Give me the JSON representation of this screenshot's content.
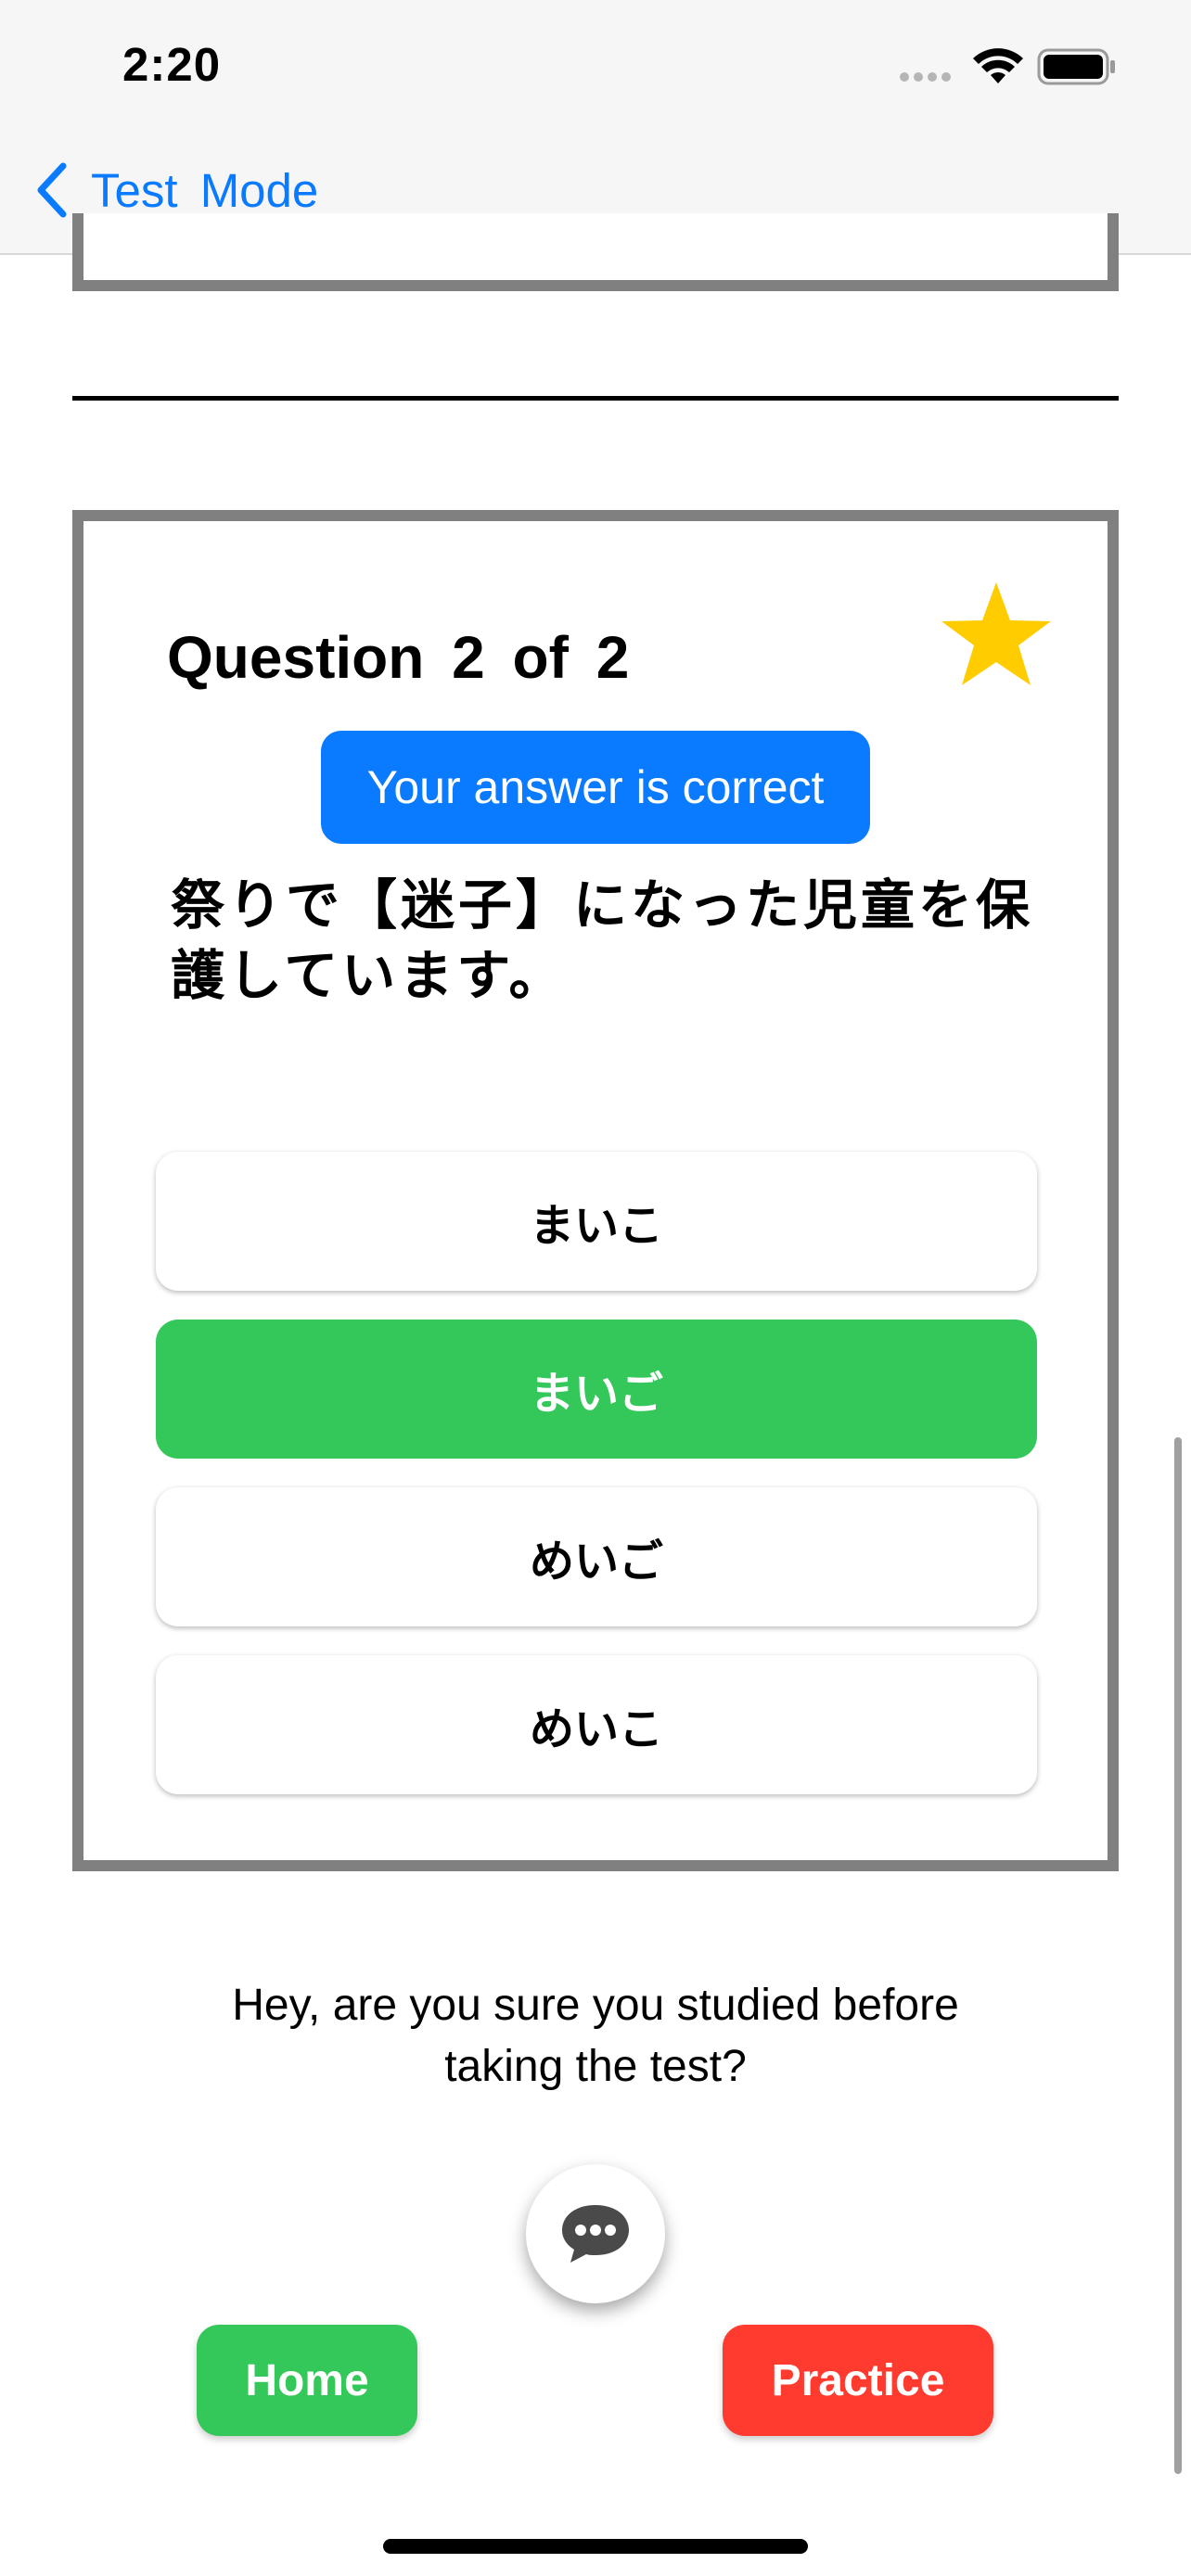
{
  "status_bar": {
    "time": "2:20"
  },
  "nav": {
    "back_label": "Test  Mode"
  },
  "question_card": {
    "title": "Question  2  of  2",
    "result_badge": "Your answer is correct",
    "question_text": "祭りで【迷子】になった児童を保護しています。",
    "options": [
      {
        "label": "まいこ",
        "state": "default"
      },
      {
        "label": "まいご",
        "state": "selected-correct"
      },
      {
        "label": "めいご",
        "state": "default"
      },
      {
        "label": "めいこ",
        "state": "default"
      }
    ]
  },
  "feedback": {
    "message": "Hey, are you sure you studied before taking the test?"
  },
  "buttons": {
    "home_label": "Home",
    "practice_label": "Practice"
  },
  "colors": {
    "accent_blue": "#0a7aff",
    "correct_green": "#34c759",
    "practice_red": "#ff3b30",
    "star_yellow": "#ffcc00",
    "card_border": "#808080"
  },
  "icons": {
    "back": "chevron-left-icon",
    "favorite": "star-icon",
    "chat": "chat-bubble-icon",
    "wifi": "wifi-icon",
    "battery": "battery-icon"
  }
}
